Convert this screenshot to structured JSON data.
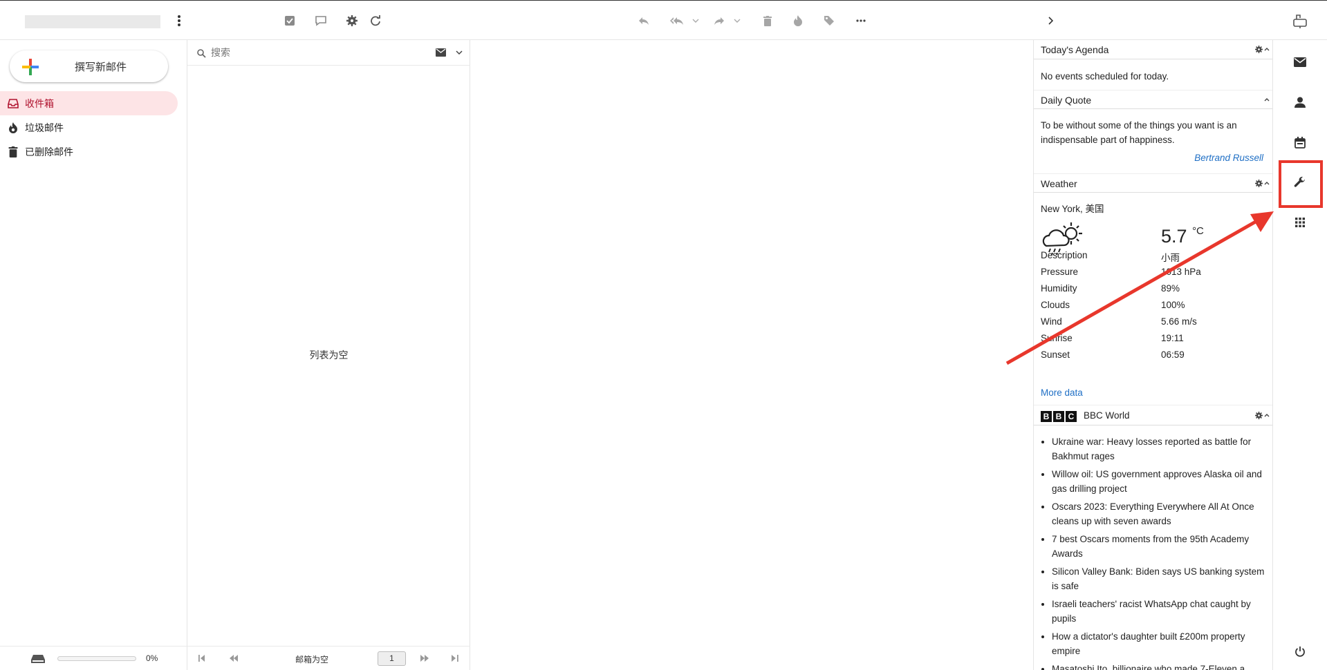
{
  "topbar": {
    "reply_label": "Reply",
    "reply_all_label": "Reply all",
    "forward_label": "Forward"
  },
  "compose": {
    "label": "撰写新邮件"
  },
  "folders": [
    {
      "label": "收件箱",
      "icon": "inbox-icon",
      "active": true
    },
    {
      "label": "垃圾邮件",
      "icon": "flame-icon",
      "active": false
    },
    {
      "label": "已删除邮件",
      "icon": "trash-icon",
      "active": false
    }
  ],
  "quota": {
    "percent": 0,
    "label": "0%"
  },
  "search": {
    "placeholder": "搜索"
  },
  "list": {
    "empty_text": "列表为空"
  },
  "pager": {
    "status": "邮箱为空",
    "page": "1"
  },
  "agenda": {
    "today": {
      "title": "Today's Agenda",
      "text": "No events scheduled for today."
    },
    "quote": {
      "title": "Daily Quote",
      "text": "To be without some of the things you want is an indispensable part of happiness.",
      "author": "Bertrand Russell"
    },
    "weather": {
      "title": "Weather",
      "location": "New York, 美国",
      "temperature": "5.7",
      "unit": "°C",
      "rows": [
        {
          "label": "Description",
          "value": "小雨"
        },
        {
          "label": "Pressure",
          "value": "1013 hPa"
        },
        {
          "label": "Humidity",
          "value": "89%"
        },
        {
          "label": "Clouds",
          "value": "100%"
        },
        {
          "label": "Wind",
          "value": "5.66 m/s"
        },
        {
          "label": "Sunrise",
          "value": "19:11"
        },
        {
          "label": "Sunset",
          "value": "06:59"
        }
      ],
      "more": "More data"
    },
    "bbc": {
      "title": "BBC World",
      "logo_letters": [
        "B",
        "B",
        "C"
      ],
      "items": [
        "Ukraine war: Heavy losses reported as battle for Bakhmut rages",
        "Willow oil: US government approves Alaska oil and gas drilling project",
        "Oscars 2023: Everything Everywhere All At Once cleans up with seven awards",
        "7 best Oscars moments from the 95th Academy Awards",
        "Silicon Valley Bank: Biden says US banking system is safe",
        "Israeli teachers' racist WhatsApp chat caught by pupils",
        "How a dictator's daughter built £200m property empire",
        "Masatoshi Ito, billionaire who made 7-Eleven a"
      ]
    }
  },
  "colors": {
    "annotation": "#e8372c",
    "active_folder_bg": "#fde4e6",
    "active_folder_text": "#b0132f",
    "link": "#1f6fc5"
  }
}
